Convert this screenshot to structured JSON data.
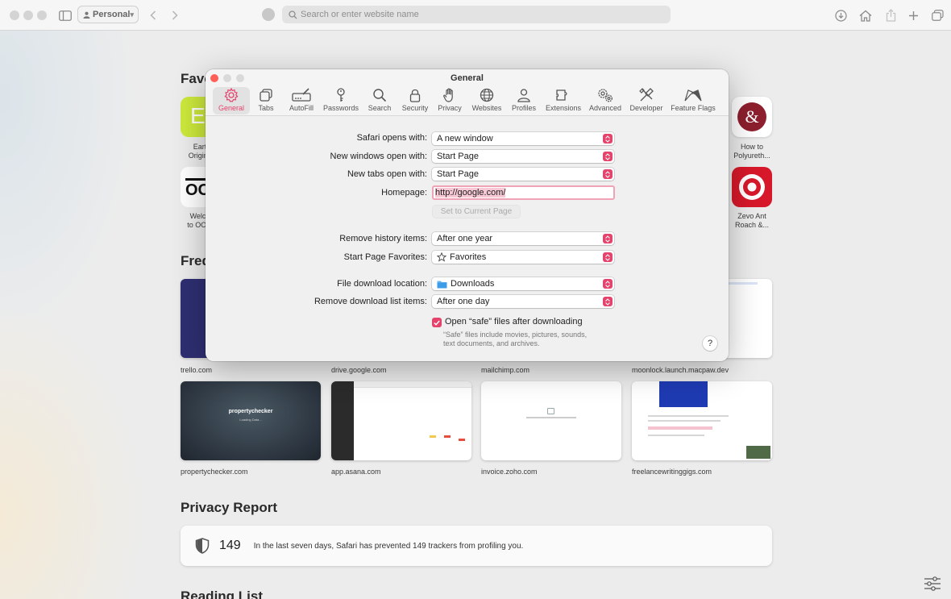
{
  "browser": {
    "profile_label": "Personal",
    "address_placeholder": "Search or enter website name"
  },
  "start_page": {
    "favorites_title": "Favorites",
    "frequently_visited_title": "Frequently Visited",
    "favorites_left": [
      {
        "label_line1": "Eart",
        "label_line2": "Origins"
      },
      {
        "label_line1": "Welco",
        "label_line2": "to OOM"
      }
    ],
    "favorites_right": [
      {
        "label_line1": "How to",
        "label_line2": "Polyureth..."
      },
      {
        "label_line1": "Zevo Ant",
        "label_line2": "Roach &..."
      }
    ],
    "thumbnails": [
      {
        "label": "trello.com"
      },
      {
        "label": "drive.google.com"
      },
      {
        "label": "mailchimp.com"
      },
      {
        "label": "moonlock.launch.macpaw.dev"
      },
      {
        "label": "propertychecker.com"
      },
      {
        "label": "app.asana.com"
      },
      {
        "label": "invoice.zoho.com"
      },
      {
        "label": "freelancewritinggigs.com"
      }
    ],
    "propertychecker_logo": "propertychecker",
    "propertychecker_sub": "Loading Data...",
    "privacy_report_title": "Privacy Report",
    "privacy_count": "149",
    "privacy_message": "In the last seven days, Safari has prevented 149 trackers from profiling you.",
    "reading_list_title": "Reading List"
  },
  "dialog": {
    "title": "General",
    "tabs": [
      {
        "label": "General",
        "icon": "gear-icon"
      },
      {
        "label": "Tabs",
        "icon": "tabs-icon"
      },
      {
        "label": "AutoFill",
        "icon": "autofill-icon"
      },
      {
        "label": "Passwords",
        "icon": "key-icon"
      },
      {
        "label": "Search",
        "icon": "magnifier-icon"
      },
      {
        "label": "Security",
        "icon": "lock-icon"
      },
      {
        "label": "Privacy",
        "icon": "hand-icon"
      },
      {
        "label": "Websites",
        "icon": "globe-icon"
      },
      {
        "label": "Profiles",
        "icon": "person-icon"
      },
      {
        "label": "Extensions",
        "icon": "puzzle-icon"
      },
      {
        "label": "Advanced",
        "icon": "gears-icon"
      },
      {
        "label": "Developer",
        "icon": "tools-icon"
      },
      {
        "label": "Feature Flags",
        "icon": "flags-icon"
      }
    ],
    "safari_opens_with": {
      "label": "Safari opens with:",
      "value": "A new window"
    },
    "new_windows_open_with": {
      "label": "New windows open with:",
      "value": "Start Page"
    },
    "new_tabs_open_with": {
      "label": "New tabs open with:",
      "value": "Start Page"
    },
    "homepage": {
      "label": "Homepage:",
      "value": "http://google.com/"
    },
    "set_current_page": "Set to Current Page",
    "remove_history": {
      "label": "Remove history items:",
      "value": "After one year"
    },
    "start_page_favorites": {
      "label": "Start Page Favorites:",
      "value": "Favorites"
    },
    "download_location": {
      "label": "File download location:",
      "value": "Downloads"
    },
    "remove_download_list": {
      "label": "Remove download list items:",
      "value": "After one day"
    },
    "open_safe_files": {
      "label": "Open “safe” files after downloading",
      "checked": true,
      "help_line1": "“Safe” files include movies, pictures, sounds,",
      "help_line2": "text documents, and archives."
    },
    "help_label": "?"
  },
  "colors": {
    "accent": "#e5436c",
    "close_button": "#ff5f57"
  }
}
